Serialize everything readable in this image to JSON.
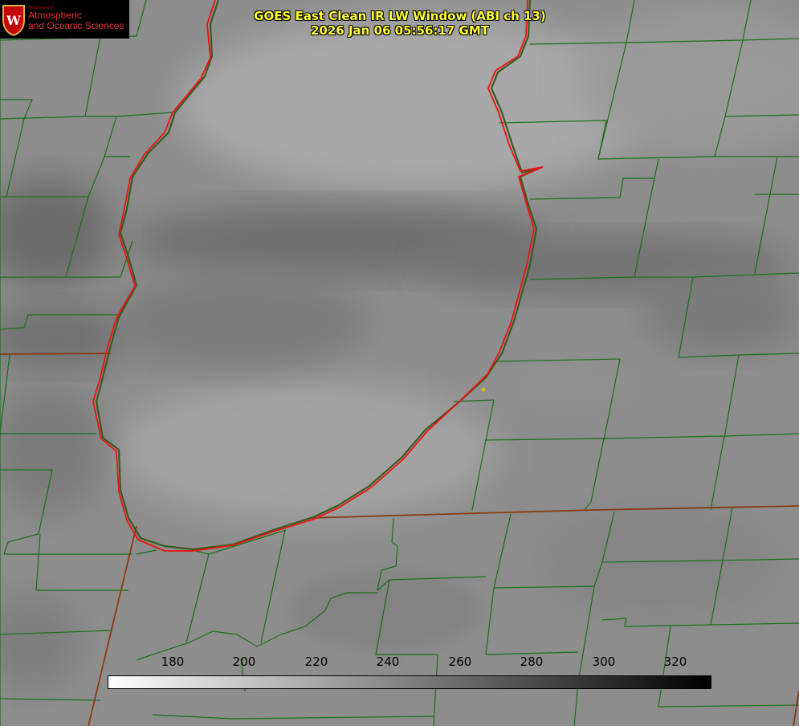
{
  "title": {
    "line1": "GOES East Clean IR LW Window (ABI ch 13)",
    "line2": "2026 Jan 06 05:56:17 GMT"
  },
  "logo": {
    "dept": "Department of",
    "line1": "Atmospheric",
    "line2": "and Oceanic Sciences",
    "crest_letter": "W",
    "color": "#c5050c"
  },
  "colorbar": {
    "ticks": [
      "180",
      "200",
      "220",
      "240",
      "260",
      "280",
      "300",
      "320"
    ],
    "gradient_start": "#ffffff",
    "gradient_end": "#000000"
  },
  "colors": {
    "coastline": "#ee1111",
    "boundaries": "#1a6e1a",
    "state_line": "#8a3a10",
    "title_text": "#ffff33",
    "marker": "#d4c200"
  }
}
